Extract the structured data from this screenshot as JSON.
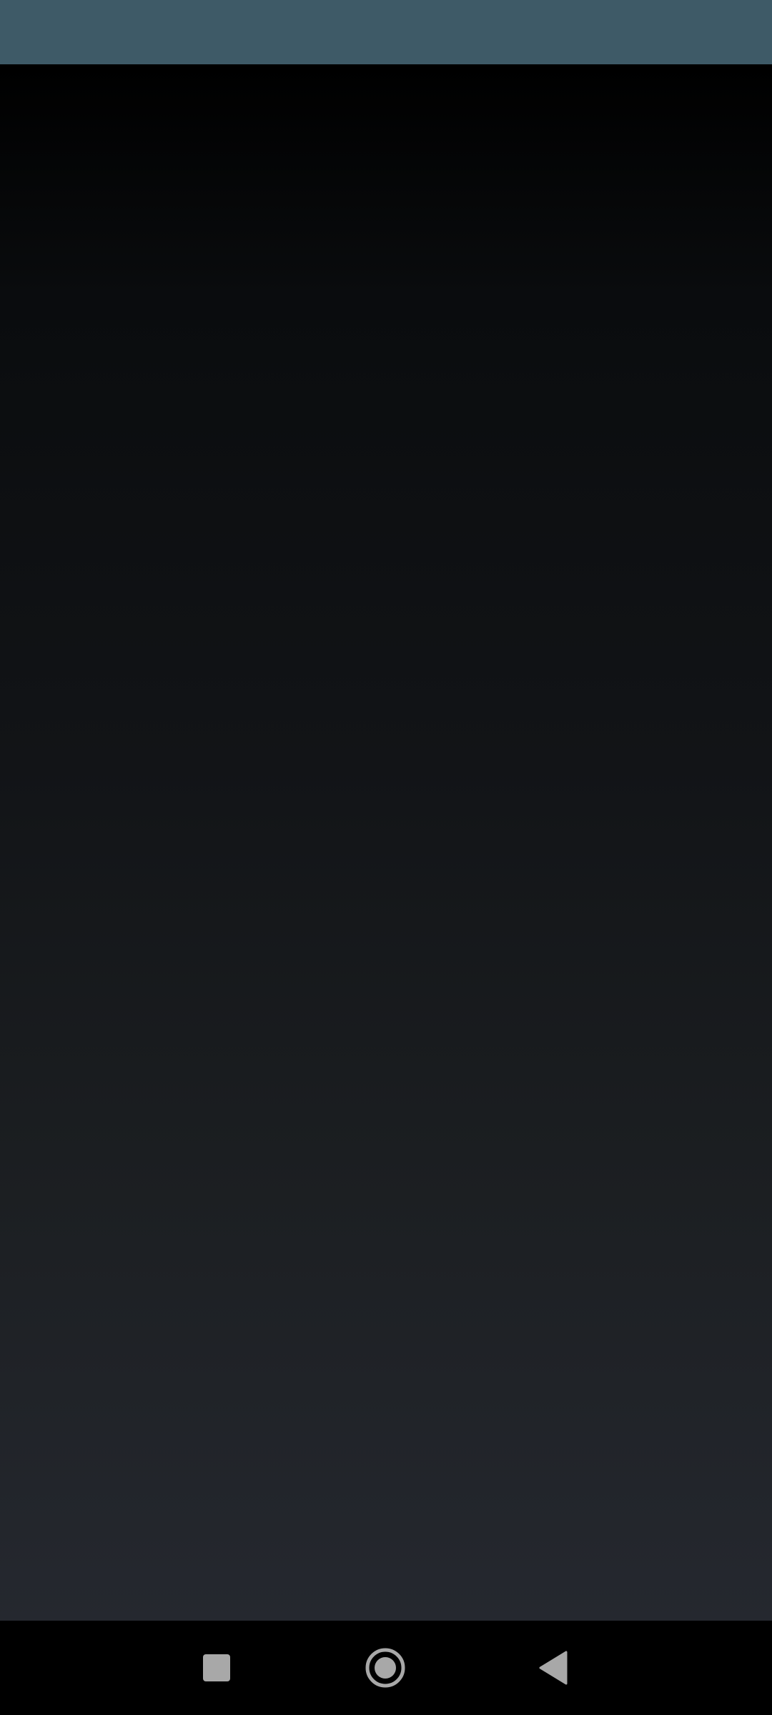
{
  "colors": {
    "status_bar": "#3e5a67",
    "content_top": "#000000",
    "content_bottom": "#25282f",
    "nav_bar": "#000000",
    "nav_icon": "#a8a8a8"
  },
  "navigation_bar": {
    "buttons": [
      {
        "icon": "recents-square-icon"
      },
      {
        "icon": "home-circle-icon"
      },
      {
        "icon": "back-triangle-icon"
      }
    ]
  }
}
